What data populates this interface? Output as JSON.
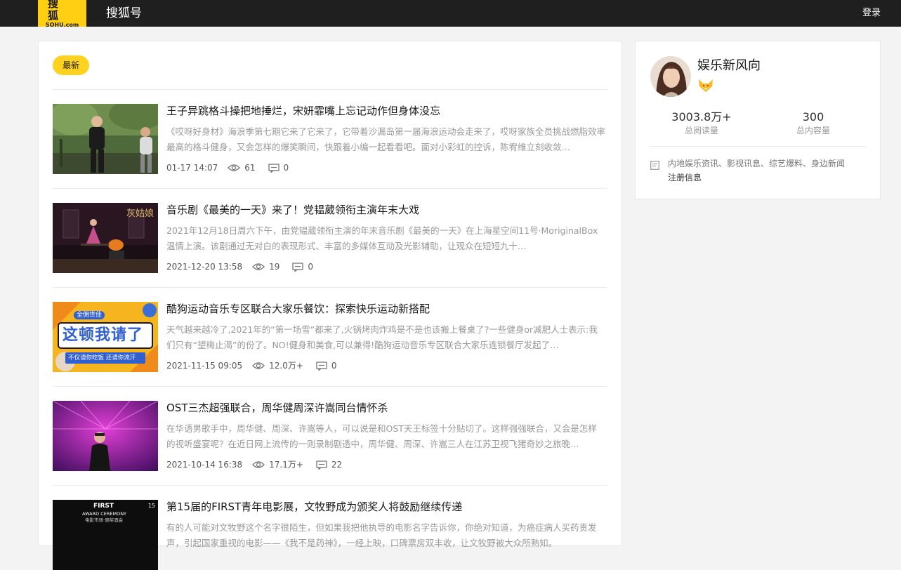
{
  "header": {
    "logo_cn": "搜狐",
    "logo_en": "SOHU.com",
    "brand": "搜狐号",
    "login": "登录"
  },
  "main": {
    "tab": "最新",
    "articles": [
      {
        "title": "王子异跳格斗操把地捶烂，宋妍霏嘴上忘记动作但身体没忘",
        "desc": "《哎呀好身材》海浪季第七期它来了它来了，它带着沙漏岛第一届海浪运动会走来了，哎呀家族全员挑战燃脂效率最高的格斗健身，又会怎样的爆笑瞬间，快跟着小编一起看看吧。面对小彩虹的控诉，陈宥维立刻收敛…",
        "date": "01-17 14:07",
        "views": "61",
        "comments": "0"
      },
      {
        "title": "音乐剧《最美的一天》来了！党韫葳领衔主演年末大戏",
        "desc": "2021年12月18日周六下午，由党韫葳领衔主演的年末音乐剧《最美的一天》在上海星空间11号·MoriginalBox温情上演。该剧通过无对白的表现形式、丰富的多媒体互动及光影辅助，让观众在短短九十…",
        "date": "2021-12-20 13:58",
        "views": "19",
        "comments": "0",
        "thumb_text": "灰姑娘"
      },
      {
        "title": "酷狗运动音乐专区联合大家乐餐饮：探索快乐运动新搭配",
        "desc": "天气越来越冷了,2021年的“第一场雪”都来了,火锅烤肉炸鸡是不是也该搬上餐桌了?一些健身or减肥人士表示:我们只有“望梅止渴”的份了。NO!健身和美食,可以兼得!酷狗运动音乐专区联合大家乐连锁餐厅发起了…",
        "date": "2021-11-15 09:05",
        "views": "12.0万+",
        "comments": "0",
        "thumb_badge": "全佣世佳",
        "thumb_main": "这顿我请了",
        "thumb_sub": "不仅请你吃饭 还请你流汗"
      },
      {
        "title": "OST三杰超强联合，周华健周深许嵩同台情怀杀",
        "desc": "在华语男歌手中，周华健、周深、许嵩等人，可以说是和OST天王标签十分贴切了。这样强强联合，又会是怎样的视听盛宴呢？在近日网上流传的一则录制剧透中，周华健、周深、许嵩三人在江苏卫视飞猪奇妙之旅晚…",
        "date": "2021-10-14 16:38",
        "views": "17.1万+",
        "comments": "22"
      },
      {
        "title": "第15届的FIRST青年电影展，文牧野成为颁奖人将鼓励继续传递",
        "desc": "有的人可能对文牧野这个名字很陌生，但如果我把他执导的电影名字告诉你，你绝对知道，为癌症病人买药贵发声，引起国家重视的电影——《我不是药神》，一经上映，口碑票房双丰收，让文牧野被大众所熟知。",
        "date": "",
        "views": "",
        "comments": "",
        "thumb_text1": "FIRST",
        "thumb_text2": "AWARD CEREMONY",
        "thumb_text3": "电影市场·颁奖酒会",
        "thumb_num": "15"
      }
    ]
  },
  "sidebar": {
    "author": "娱乐新风向",
    "reads_value": "3003.8万+",
    "reads_label": "总阅读量",
    "content_value": "300",
    "content_label": "总内容量",
    "tags": "内地娱乐资讯、影视讯息、综艺爆料、身边新闻",
    "register": "注册信息"
  },
  "colors": {
    "accent": "#ffd21f",
    "topbar": "#1f1f1f",
    "logo": "#ffcf14"
  }
}
